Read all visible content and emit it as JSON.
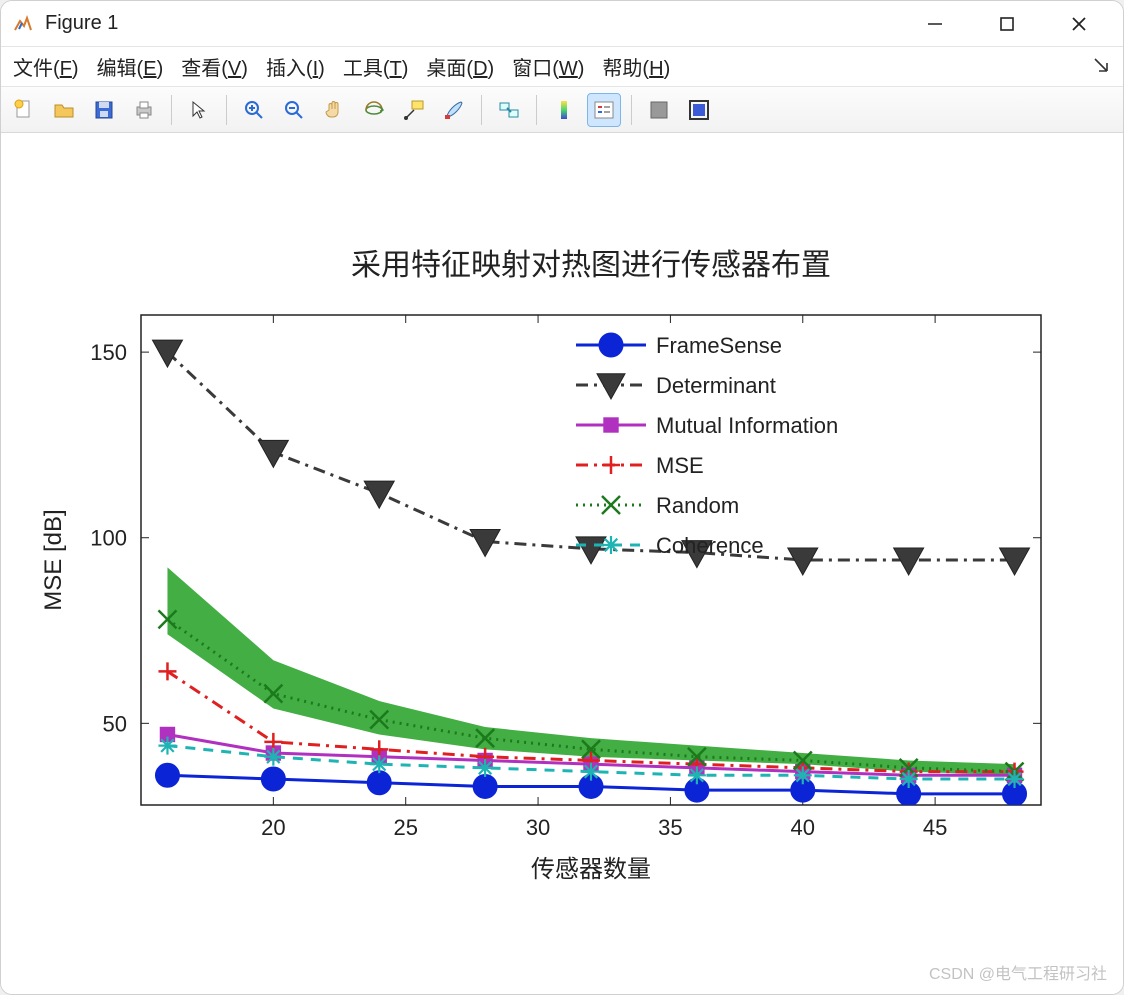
{
  "window": {
    "title": "Figure 1"
  },
  "menus": {
    "file": "文件(F)",
    "edit": "编辑(E)",
    "view": "查看(V)",
    "insert": "插入(I)",
    "tools": "工具(T)",
    "desktop": "桌面(D)",
    "window": "窗口(W)",
    "help": "帮助(H)"
  },
  "toolbar_icons": {
    "new": "new-file",
    "open": "open-folder",
    "save": "save-disk",
    "print": "printer",
    "pointer": "pointer",
    "zoom_in": "zoom-in",
    "zoom_out": "zoom-out",
    "pan": "hand",
    "rotate3d": "rotate-3d",
    "datacursor": "data-cursor",
    "brush": "brush",
    "link": "link-plots",
    "colorbar": "colorbar",
    "legend": "legend",
    "hide": "hide-plot",
    "subplot": "subplot"
  },
  "watermark": "CSDN @电气工程研习社",
  "chart_data": {
    "type": "line",
    "title": "采用特征映射对热图进行传感器布置",
    "xlabel": "传感器数量",
    "ylabel": "MSE [dB]",
    "x": [
      16,
      20,
      24,
      28,
      32,
      36,
      40,
      44,
      48
    ],
    "xticks": [
      20,
      25,
      30,
      35,
      40,
      45
    ],
    "yticks": [
      50,
      100,
      150
    ],
    "xlim": [
      15,
      49
    ],
    "ylim": [
      28,
      160
    ],
    "series": [
      {
        "name": "FrameSense",
        "color": "#0b24d6",
        "marker": "filled-circle",
        "line": "solid",
        "values": [
          36,
          35,
          34,
          33,
          33,
          32,
          32,
          31,
          31
        ]
      },
      {
        "name": "Determinant",
        "color": "#3a3a3a",
        "marker": "filled-triangle-down",
        "line": "dashdot",
        "values": [
          150,
          123,
          112,
          99,
          97,
          96,
          94,
          94,
          94
        ]
      },
      {
        "name": "Mutual Information",
        "color": "#b030c0",
        "marker": "filled-square",
        "line": "solid",
        "values": [
          47,
          42,
          41,
          40,
          39,
          38,
          37,
          36,
          36
        ]
      },
      {
        "name": "MSE",
        "color": "#e02020",
        "marker": "plus",
        "line": "dashdot",
        "values": [
          64,
          45,
          43,
          41,
          40,
          39,
          38,
          37,
          37
        ]
      },
      {
        "name": "Random",
        "color": "#1b7a1b",
        "marker": "x",
        "line": "dotted",
        "values": [
          78,
          58,
          51,
          46,
          43,
          41,
          40,
          38,
          37
        ],
        "band_upper": [
          92,
          67,
          56,
          49,
          46,
          44,
          42,
          40,
          39
        ],
        "band_lower": [
          74,
          54,
          47,
          43,
          41,
          40,
          39,
          37,
          36
        ]
      },
      {
        "name": "Coherence",
        "color": "#1fb4b4",
        "marker": "asterisk",
        "line": "dashed",
        "values": [
          44,
          41,
          39,
          38,
          37,
          36,
          36,
          35,
          35
        ]
      }
    ],
    "legend_position": "top-right"
  }
}
